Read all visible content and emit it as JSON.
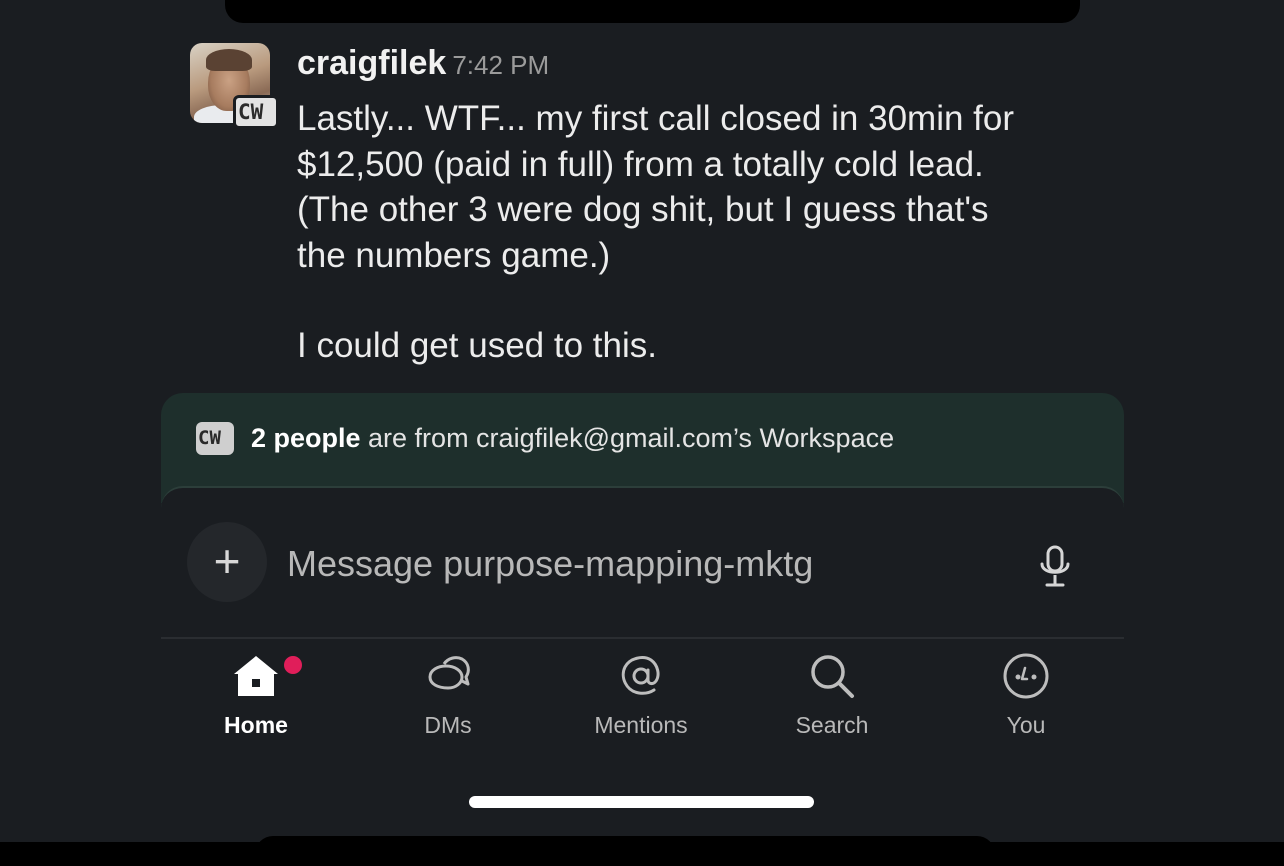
{
  "message": {
    "username": "craigfilek",
    "timestamp": "7:42 PM",
    "workspace_badge": "CW",
    "lines": [
      "Lastly... WTF... my first call closed in 30min for",
      "$12,500 (paid in full) from a totally cold lead.",
      "(The other 3 were dog shit, but I guess that's",
      "the numbers game.)",
      "I could get used to this."
    ]
  },
  "notice": {
    "badge": "CW",
    "count_text": "2 people",
    "rest_text": " are from craigfilek@gmail.com’s Workspace"
  },
  "composer": {
    "plus_label": "+",
    "placeholder": "Message purpose-mapping-mktg"
  },
  "tabs": [
    {
      "label": "Home",
      "icon": "home-icon",
      "active": true,
      "badge": "unread-dot"
    },
    {
      "label": "DMs",
      "icon": "dms-icon",
      "active": false
    },
    {
      "label": "Mentions",
      "icon": "at-icon",
      "active": false
    },
    {
      "label": "Search",
      "icon": "search-icon",
      "active": false
    },
    {
      "label": "You",
      "icon": "you-icon",
      "active": false
    }
  ],
  "colors": {
    "background": "#1a1d21",
    "notice_bg": "#1e2f2c",
    "unread_dot": "#e01e5a"
  }
}
